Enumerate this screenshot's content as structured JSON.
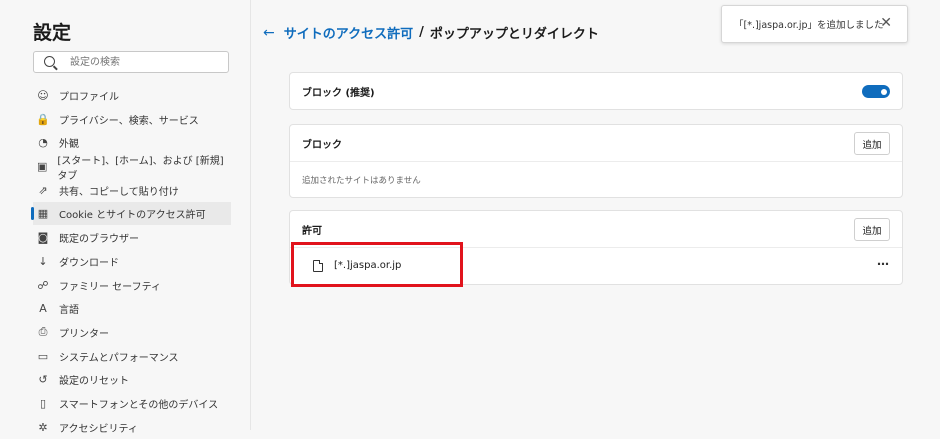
{
  "sidebar": {
    "title": "設定",
    "search_placeholder": "設定の検索",
    "items": [
      {
        "label": "プロファイル",
        "icon": "profile-icon",
        "glyph": "☺"
      },
      {
        "label": "プライバシー、検索、サービス",
        "icon": "lock-icon",
        "glyph": "🔒"
      },
      {
        "label": "外観",
        "icon": "appearance-icon",
        "glyph": "◔"
      },
      {
        "label": "[スタート]、[ホーム]、および [新規] タブ",
        "icon": "home-tabs-icon",
        "glyph": "▣"
      },
      {
        "label": "共有、コピーして貼り付け",
        "icon": "share-icon",
        "glyph": "⇗"
      },
      {
        "label": "Cookie とサイトのアクセス許可",
        "icon": "cookie-permissions-icon",
        "glyph": "▦",
        "active": true
      },
      {
        "label": "既定のブラウザー",
        "icon": "default-browser-icon",
        "glyph": "◙"
      },
      {
        "label": "ダウンロード",
        "icon": "download-icon",
        "glyph": "↓"
      },
      {
        "label": "ファミリー セーフティ",
        "icon": "family-icon",
        "glyph": "☍"
      },
      {
        "label": "言語",
        "icon": "language-icon",
        "glyph": "A"
      },
      {
        "label": "プリンター",
        "icon": "printer-icon",
        "glyph": "⎙"
      },
      {
        "label": "システムとパフォーマンス",
        "icon": "system-icon",
        "glyph": "▭"
      },
      {
        "label": "設定のリセット",
        "icon": "reset-icon",
        "glyph": "↺"
      },
      {
        "label": "スマートフォンとその他のデバイス",
        "icon": "phone-icon",
        "glyph": "▯"
      },
      {
        "label": "アクセシビリティ",
        "icon": "accessibility-icon",
        "glyph": "✲"
      }
    ]
  },
  "header": {
    "back_glyph": "←",
    "parent": "サイトのアクセス許可",
    "separator": "/",
    "current": "ポップアップとリダイレクト"
  },
  "toast": {
    "message": "「[*.]jaspa.or.jp」を追加しました",
    "close_glyph": "✕"
  },
  "block_recommended": {
    "label": "ブロック (推奨)",
    "enabled": true
  },
  "block": {
    "label": "ブロック",
    "add_label": "追加",
    "empty_text": "追加されたサイトはありません"
  },
  "allow": {
    "label": "許可",
    "add_label": "追加",
    "sites": [
      "[*.]jaspa.or.jp"
    ],
    "more_glyph": "⋯"
  },
  "colors": {
    "accent": "#0f6cbd",
    "highlight": "#e1131c"
  }
}
